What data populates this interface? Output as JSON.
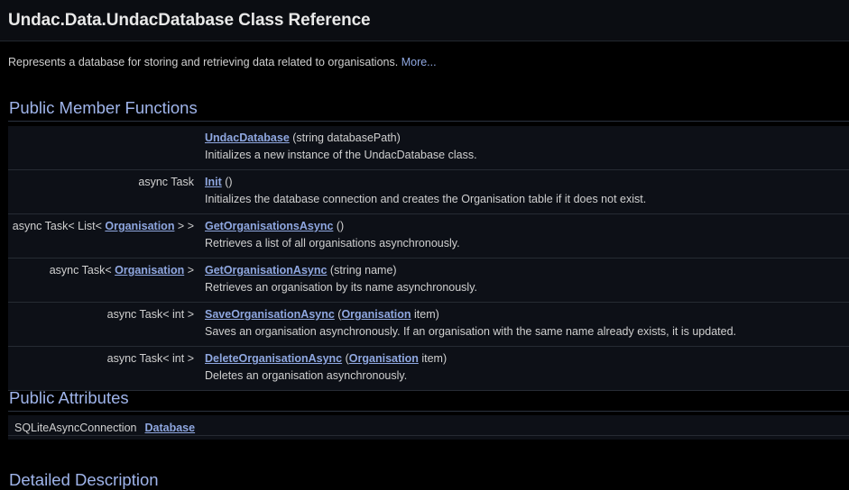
{
  "header": {
    "title": "Undac.Data.UndacDatabase Class Reference"
  },
  "brief": {
    "text": "Represents a database for storing and retrieving data related to organisations.",
    "more_link": "More..."
  },
  "sections": {
    "functions_title": "Public Member Functions",
    "attributes_title": "Public Attributes",
    "detailed_title": "Detailed Description"
  },
  "functions": [
    {
      "return_prefix": "",
      "return_link": "",
      "return_suffix": "",
      "name": "UndacDatabase",
      "args_prefix": " (string databasePath)",
      "arg_link": "",
      "args_suffix": "",
      "desc": "Initializes a new instance of the UndacDatabase class."
    },
    {
      "return_prefix": "async Task ",
      "return_link": "",
      "return_suffix": "",
      "name": "Init",
      "args_prefix": " ()",
      "arg_link": "",
      "args_suffix": "",
      "desc": "Initializes the database connection and creates the Organisation table if it does not exist."
    },
    {
      "return_prefix": "async Task< List< ",
      "return_link": "Organisation",
      "return_suffix": " > > ",
      "name": "GetOrganisationsAsync",
      "args_prefix": " ()",
      "arg_link": "",
      "args_suffix": "",
      "desc": "Retrieves a list of all organisations asynchronously."
    },
    {
      "return_prefix": "async Task< ",
      "return_link": "Organisation",
      "return_suffix": " > ",
      "name": "GetOrganisationAsync",
      "args_prefix": " (string name)",
      "arg_link": "",
      "args_suffix": "",
      "desc": "Retrieves an organisation by its name asynchronously."
    },
    {
      "return_prefix": "async Task< int > ",
      "return_link": "",
      "return_suffix": "",
      "name": "SaveOrganisationAsync",
      "args_prefix": " (",
      "arg_link": "Organisation",
      "args_suffix": " item)",
      "desc": "Saves an organisation asynchronously. If an organisation with the same name already exists, it is updated."
    },
    {
      "return_prefix": "async Task< int > ",
      "return_link": "",
      "return_suffix": "",
      "name": "DeleteOrganisationAsync",
      "args_prefix": " (",
      "arg_link": "Organisation",
      "args_suffix": " item)",
      "desc": "Deletes an organisation asynchronously."
    }
  ],
  "attributes": [
    {
      "type": "SQLiteAsyncConnection",
      "name": "Database"
    }
  ]
}
